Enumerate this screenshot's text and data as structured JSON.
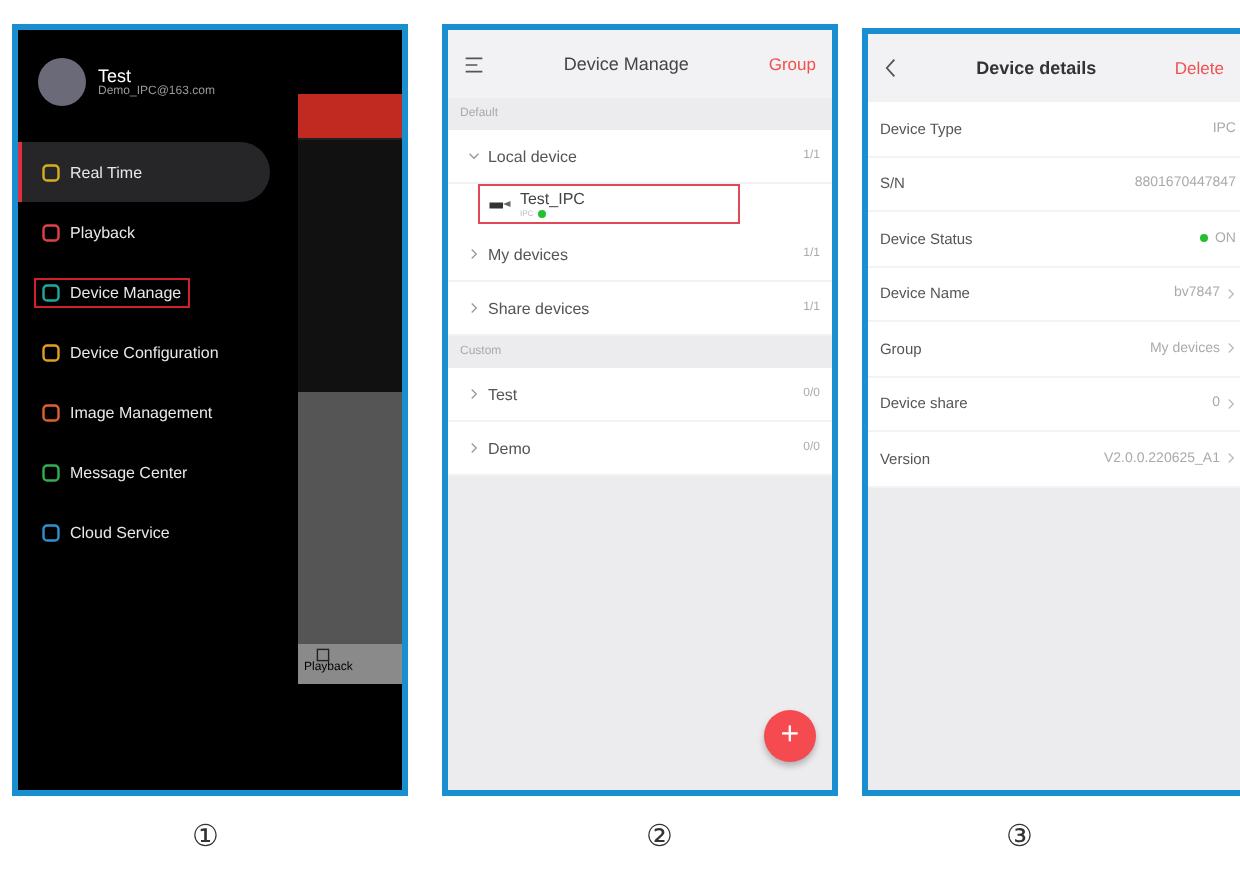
{
  "menu_screen": {
    "user": {
      "name": "Test",
      "email": "Demo_IPC@163.com"
    },
    "items": [
      {
        "label": "Real Time",
        "selected": true,
        "highlighted": false,
        "color": "#d4b020"
      },
      {
        "label": "Playback",
        "selected": false,
        "highlighted": false,
        "color": "#e0404a"
      },
      {
        "label": "Device Manage",
        "selected": false,
        "highlighted": true,
        "color": "#20a8a0"
      },
      {
        "label": "Device Configuration",
        "selected": false,
        "highlighted": false,
        "color": "#e0a020"
      },
      {
        "label": "Image Management",
        "selected": false,
        "highlighted": false,
        "color": "#e06030"
      },
      {
        "label": "Message Center",
        "selected": false,
        "highlighted": false,
        "color": "#30b050"
      },
      {
        "label": "Cloud Service",
        "selected": false,
        "highlighted": false,
        "color": "#3090d0"
      }
    ],
    "background_tab": "Playback"
  },
  "device_manage_screen": {
    "title": "Device Manage",
    "action": "Group",
    "sections": [
      {
        "header": "Default",
        "groups": [
          {
            "name": "Local device",
            "count": "1/1",
            "expanded": true,
            "children": [
              {
                "name": "Test_IPC",
                "type": "IPC",
                "online": true,
                "highlighted": true
              }
            ]
          },
          {
            "name": "My devices",
            "count": "1/1",
            "expanded": false
          },
          {
            "name": "Share devices",
            "count": "1/1",
            "expanded": false
          }
        ]
      },
      {
        "header": "Custom",
        "groups": [
          {
            "name": "Test",
            "count": "0/0",
            "expanded": false
          },
          {
            "name": "Demo",
            "count": "0/0",
            "expanded": false
          }
        ]
      }
    ],
    "add_button": "+"
  },
  "details_screen": {
    "title": "Device details",
    "action": "Delete",
    "rows": [
      {
        "label": "Device Type",
        "value": "IPC",
        "kind": "plain"
      },
      {
        "label": "S/N",
        "value": "8801670447847",
        "kind": "plain"
      },
      {
        "label": "Device Status",
        "value": "ON",
        "kind": "status",
        "online": true
      },
      {
        "label": "Device Name",
        "value": "bv7847",
        "kind": "link"
      },
      {
        "label": "Group",
        "value": "My devices",
        "kind": "link"
      },
      {
        "label": "Device share",
        "value": "0",
        "kind": "link"
      },
      {
        "label": "Version",
        "value": "V2.0.0.220625_A1",
        "kind": "link"
      }
    ]
  },
  "captions": [
    "①",
    "②",
    "③"
  ]
}
